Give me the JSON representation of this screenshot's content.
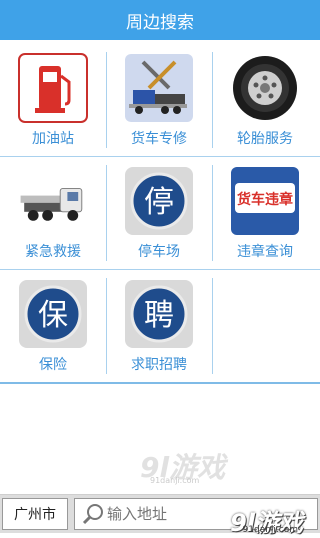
{
  "header": {
    "title": "周边搜索"
  },
  "grid": [
    {
      "label": "加油站",
      "icon": "gas-station-icon"
    },
    {
      "label": "货车专修",
      "icon": "truck-repair-icon"
    },
    {
      "label": "轮胎服务",
      "icon": "tire-icon"
    },
    {
      "label": "紧急救援",
      "icon": "tow-truck-icon"
    },
    {
      "label": "停车场",
      "icon": "parking-icon",
      "glyph": "停"
    },
    {
      "label": "违章查询",
      "icon": "violation-icon",
      "glyph": "货车违章"
    },
    {
      "label": "保险",
      "icon": "insurance-icon",
      "glyph": "保"
    },
    {
      "label": "求职招聘",
      "icon": "recruit-icon",
      "glyph": "聘"
    }
  ],
  "bottom": {
    "city": "广州市",
    "search_placeholder": "输入地址"
  },
  "watermark": {
    "brand": "9l游戏",
    "site": "91danji.com"
  },
  "colors": {
    "header_bg": "#3fa2e8",
    "label_text": "#3a8fd6",
    "divider": "#a9d1ee"
  }
}
